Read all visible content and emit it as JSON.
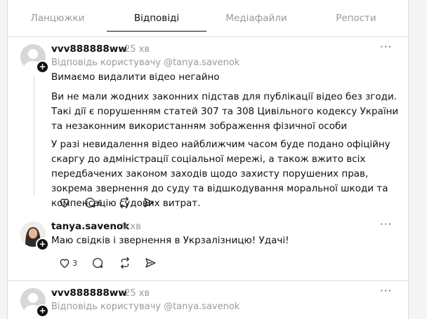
{
  "tabs": [
    "Ланцюжки",
    "Відповіді",
    "Медіафайли",
    "Репости"
  ],
  "active_tab": "Відповіді",
  "posts": [
    {
      "username": "vvv888888ww",
      "time": "25 хв",
      "reply_to": "Відповідь користувачу @tanya.savenok",
      "paragraphs": [
        "Вимаємо видалити відео негайно",
        "Ви не мали жодних законних підстав для публікації відео без згоди. Такі дії є порушенням статей 307 та 308 Цивільного кодексу України та незаконним використанням зображення фізичної особи",
        "У разі невидалення відео найближчим часом буде подано офіційну скаргу до адміністрації соціальної мережі, а також вжито всіх передбачених законом заходів щодо захисту порушених прав, зокрема звернення до суду та відшкодування моральної шкоди та компенсацію судових витрат."
      ],
      "likes": "",
      "replies": "6"
    },
    {
      "username": "tanya.savenok",
      "time": "9 хв",
      "text": "Маю свідків і звернення в Укрзалізницю! Удачі!",
      "likes": "3",
      "replies": ""
    },
    {
      "username": "vvv888888ww",
      "time": "25 хв",
      "reply_to": "Відповідь користувачу @tanya.savenok"
    }
  ],
  "more_label": "···",
  "icons": [
    "heart-icon",
    "comment-icon",
    "repost-icon",
    "share-icon",
    "more-icon",
    "follow-plus-icon"
  ]
}
